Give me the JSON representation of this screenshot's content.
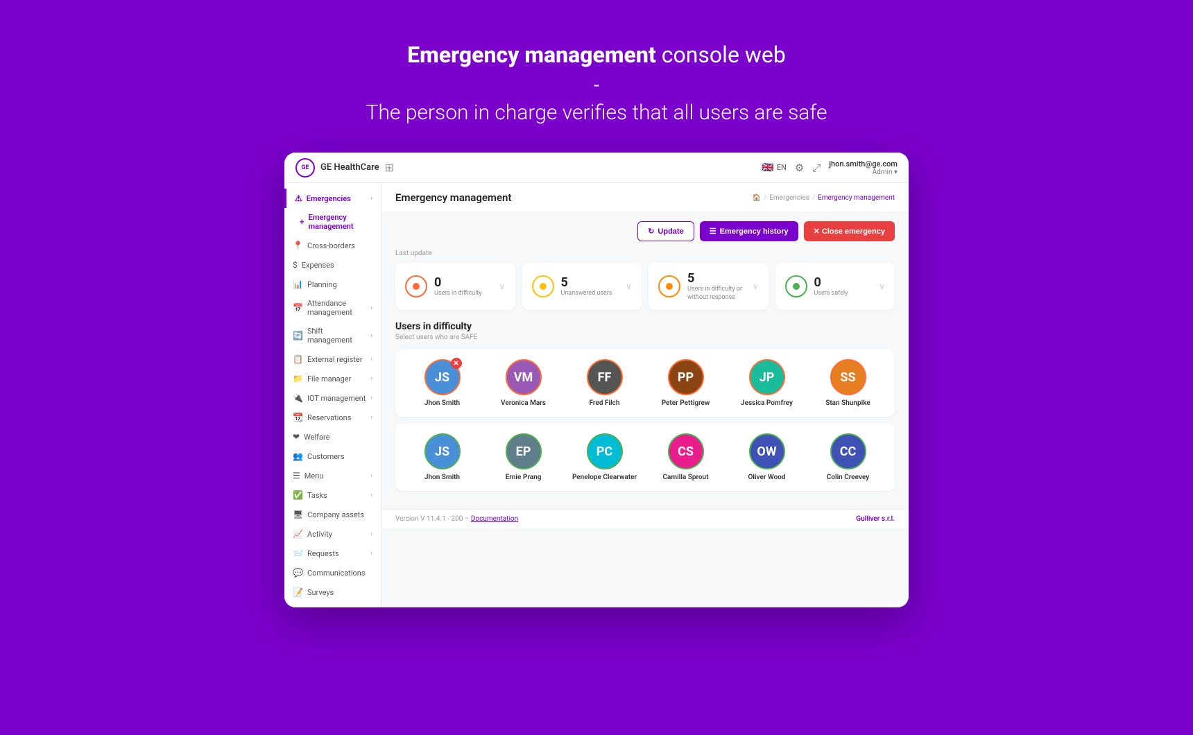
{
  "hero": {
    "title_bold": "Emergency management",
    "title_normal": " console web",
    "dash": "-",
    "subtitle": "The person in charge verifies that all users are safe"
  },
  "topbar": {
    "brand": "GE HealthCare",
    "logo_text": "GE",
    "lang": "EN",
    "user_email": "jhon.smith@ge.com",
    "user_role": "Admin ▾"
  },
  "sidebar": {
    "items": [
      {
        "label": "Emergencies",
        "icon": "⚠",
        "active_parent": true,
        "has_chevron": true
      },
      {
        "label": "Emergency management",
        "icon": "+",
        "active_child": true
      },
      {
        "label": "Cross-borders",
        "icon": "📍",
        "has_chevron": false
      },
      {
        "label": "Expenses",
        "icon": "$",
        "has_chevron": false
      },
      {
        "label": "Planning",
        "icon": "📊",
        "has_chevron": false
      },
      {
        "label": "Attendance management",
        "icon": "📅",
        "has_chevron": true
      },
      {
        "label": "Shift management",
        "icon": "🔄",
        "has_chevron": true
      },
      {
        "label": "External register",
        "icon": "📋",
        "has_chevron": true
      },
      {
        "label": "File manager",
        "icon": "📁",
        "has_chevron": true
      },
      {
        "label": "IOT management",
        "icon": "🔌",
        "has_chevron": true
      },
      {
        "label": "Reservations",
        "icon": "📆",
        "has_chevron": true
      },
      {
        "label": "Welfare",
        "icon": "❤",
        "has_chevron": false
      },
      {
        "label": "Customers",
        "icon": "👥",
        "has_chevron": false
      },
      {
        "label": "Menu",
        "icon": "☰",
        "has_chevron": true
      },
      {
        "label": "Tasks",
        "icon": "✅",
        "has_chevron": true
      },
      {
        "label": "Company assets",
        "icon": "🖥",
        "has_chevron": false
      },
      {
        "label": "Activity",
        "icon": "📈",
        "has_chevron": true
      },
      {
        "label": "Requests",
        "icon": "📨",
        "has_chevron": true
      },
      {
        "label": "Communications",
        "icon": "💬",
        "has_chevron": false
      },
      {
        "label": "Surveys",
        "icon": "📝",
        "has_chevron": false
      }
    ]
  },
  "page": {
    "title": "Emergency management",
    "breadcrumb": {
      "home": "🏠",
      "path1": "Emergencies",
      "path2": "Emergency management"
    }
  },
  "actions": {
    "update": "Update",
    "emergency_history": "Emergency history",
    "close_emergency": "✕  Close emergency"
  },
  "stats": {
    "last_update": "Last update",
    "cards": [
      {
        "number": "0",
        "label": "Users in difficulty",
        "dot_class": "dot-orange",
        "ring_class": "ring-orange"
      },
      {
        "number": "5",
        "label": "Unanswered users",
        "dot_class": "dot-yellow",
        "ring_class": "ring-yellow"
      },
      {
        "number": "5",
        "label": "Users in difficulty or without response",
        "dot_class": "dot-orange2",
        "ring_class": "ring-orange2"
      },
      {
        "number": "0",
        "label": "Users safely",
        "dot_class": "dot-green",
        "ring_class": "ring-green"
      }
    ]
  },
  "users_section": {
    "title": "Users in difficulty",
    "subtitle": "Select users who are SAFE",
    "row1": [
      {
        "name": "Jhon Smith",
        "initials": "JS",
        "color": "av-blue",
        "ring": "avatar-ring-orange",
        "badge": true
      },
      {
        "name": "Veronica Mars",
        "initials": "VM",
        "color": "av-purple",
        "ring": "avatar-ring-orange",
        "badge": false
      },
      {
        "name": "Fred Filch",
        "initials": "FF",
        "color": "av-dark",
        "ring": "avatar-ring-orange",
        "badge": false
      },
      {
        "name": "Peter Pettigrew",
        "initials": "PP",
        "color": "av-brown",
        "ring": "avatar-ring-orange",
        "badge": false
      },
      {
        "name": "Jessica Pomfrey",
        "initials": "JP",
        "color": "av-teal",
        "ring": "avatar-ring-orange",
        "badge": false
      },
      {
        "name": "Stan Shunpike",
        "initials": "SS",
        "color": "av-orange",
        "ring": "avatar-ring-orange",
        "badge": false
      }
    ],
    "row2": [
      {
        "name": "Jhon Smith",
        "initials": "JS",
        "color": "av-blue",
        "ring": "avatar-ring-green",
        "badge": false
      },
      {
        "name": "Ernie Prang",
        "initials": "EP",
        "color": "av-gray",
        "ring": "avatar-ring-green",
        "badge": false
      },
      {
        "name": "Penelope Clearwater",
        "initials": "PC",
        "color": "av-cyan",
        "ring": "avatar-ring-green",
        "badge": false
      },
      {
        "name": "Camilla Sprout",
        "initials": "CS",
        "color": "av-pink",
        "ring": "avatar-ring-green",
        "badge": false
      },
      {
        "name": "Oliver Wood",
        "initials": "OW",
        "color": "av-indigo",
        "ring": "avatar-ring-green",
        "badge": false
      },
      {
        "name": "Colin Creevey",
        "initials": "CC",
        "color": "av-indigo",
        "ring": "avatar-ring-green",
        "badge": false
      }
    ]
  },
  "footer": {
    "version": "Version V 11.4.1 - 200 – ",
    "doc_link": "Documentation",
    "brand": "Gulliver s.r.l."
  }
}
